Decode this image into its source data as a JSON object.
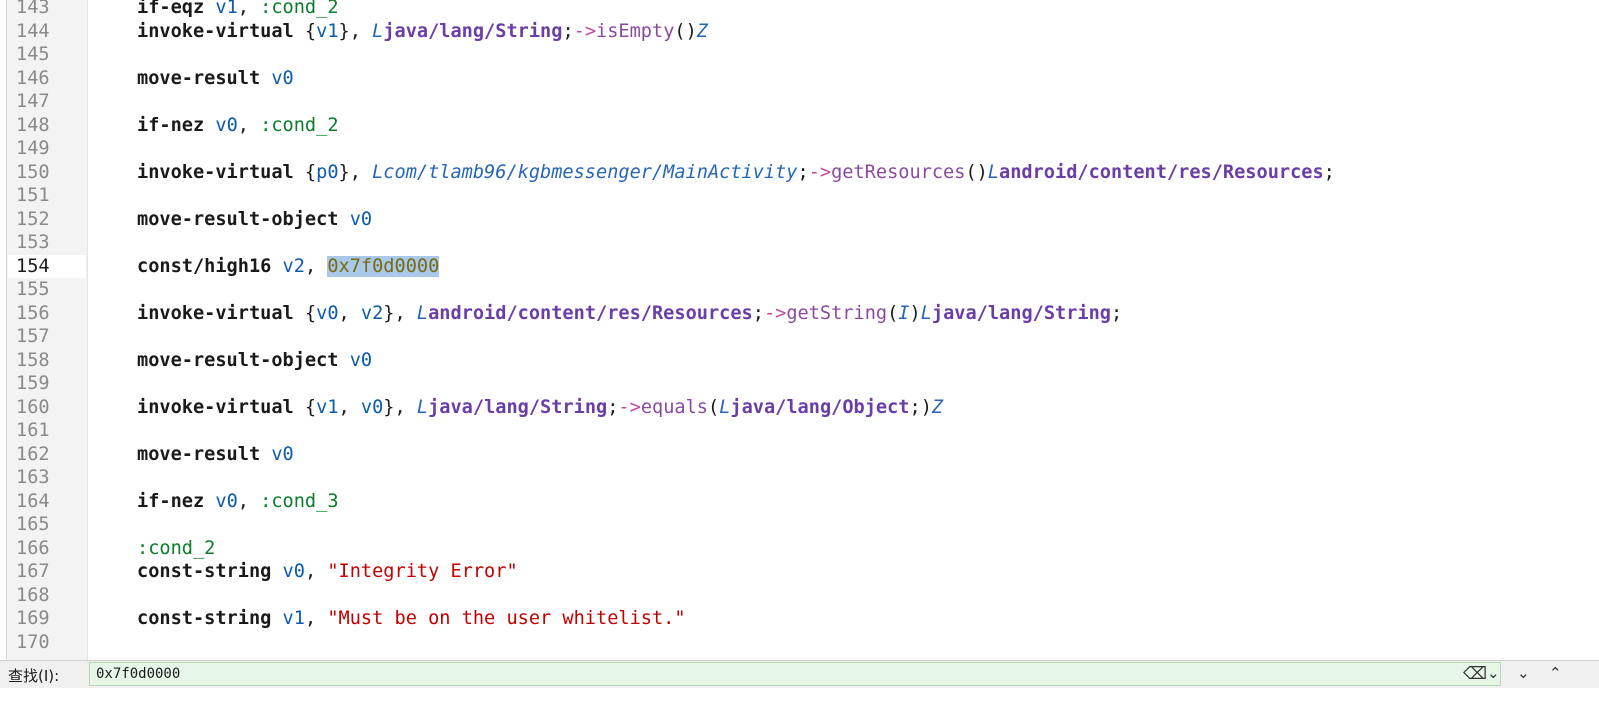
{
  "editor": {
    "lines": [
      {
        "num": "143",
        "parts": [
          [
            "kw",
            "if-eqz"
          ],
          [
            "plain",
            " "
          ],
          [
            "reg",
            "v1"
          ],
          [
            "plain",
            ", "
          ],
          [
            "lbl",
            ":cond_2"
          ]
        ]
      },
      {
        "num": "144",
        "parts": [
          [
            "kw",
            "invoke-virtual"
          ],
          [
            "plain",
            " {"
          ],
          [
            "reg",
            "v1"
          ],
          [
            "plain",
            "}, "
          ],
          [
            "clsL",
            "L"
          ],
          [
            "cls",
            "java/lang/String"
          ],
          [
            "plain",
            ";"
          ],
          [
            "arrow",
            "->"
          ],
          [
            "meth",
            "isEmpty"
          ],
          [
            "plain",
            "()"
          ],
          [
            "prim",
            "Z"
          ]
        ]
      },
      {
        "num": "145",
        "parts": []
      },
      {
        "num": "146",
        "parts": [
          [
            "kw",
            "move-result"
          ],
          [
            "plain",
            " "
          ],
          [
            "reg",
            "v0"
          ]
        ]
      },
      {
        "num": "147",
        "parts": []
      },
      {
        "num": "148",
        "parts": [
          [
            "kw",
            "if-nez"
          ],
          [
            "plain",
            " "
          ],
          [
            "reg",
            "v0"
          ],
          [
            "plain",
            ", "
          ],
          [
            "lbl",
            ":cond_2"
          ]
        ]
      },
      {
        "num": "149",
        "parts": []
      },
      {
        "num": "150",
        "parts": [
          [
            "kw",
            "invoke-virtual"
          ],
          [
            "plain",
            " {"
          ],
          [
            "reg",
            "p0"
          ],
          [
            "plain",
            "}, "
          ],
          [
            "pkgL",
            "Lcom/tlamb96/kgbmessenger/MainActivity"
          ],
          [
            "plain",
            ";"
          ],
          [
            "arrow",
            "->"
          ],
          [
            "meth",
            "getResources"
          ],
          [
            "plain",
            "()"
          ],
          [
            "clsL",
            "L"
          ],
          [
            "cls",
            "android/content/res/Resources"
          ],
          [
            "plain",
            ";"
          ]
        ]
      },
      {
        "num": "151",
        "parts": []
      },
      {
        "num": "152",
        "parts": [
          [
            "kw",
            "move-result-object"
          ],
          [
            "plain",
            " "
          ],
          [
            "reg",
            "v0"
          ]
        ]
      },
      {
        "num": "153",
        "parts": []
      },
      {
        "num": "154",
        "current": true,
        "parts": [
          [
            "kw",
            "const/high16"
          ],
          [
            "plain",
            " "
          ],
          [
            "reg",
            "v2"
          ],
          [
            "plain",
            ", "
          ],
          [
            "hexhl",
            "0x7f0d0000"
          ]
        ]
      },
      {
        "num": "155",
        "parts": []
      },
      {
        "num": "156",
        "parts": [
          [
            "kw",
            "invoke-virtual"
          ],
          [
            "plain",
            " {"
          ],
          [
            "reg",
            "v0"
          ],
          [
            "plain",
            ", "
          ],
          [
            "reg",
            "v2"
          ],
          [
            "plain",
            "}, "
          ],
          [
            "clsL",
            "L"
          ],
          [
            "cls",
            "android/content/res/Resources"
          ],
          [
            "plain",
            ";"
          ],
          [
            "arrow",
            "->"
          ],
          [
            "meth",
            "getString"
          ],
          [
            "plain",
            "("
          ],
          [
            "prim",
            "I"
          ],
          [
            "plain",
            ")"
          ],
          [
            "clsL",
            "L"
          ],
          [
            "cls",
            "java/lang/String"
          ],
          [
            "plain",
            ";"
          ]
        ]
      },
      {
        "num": "157",
        "parts": []
      },
      {
        "num": "158",
        "parts": [
          [
            "kw",
            "move-result-object"
          ],
          [
            "plain",
            " "
          ],
          [
            "reg",
            "v0"
          ]
        ]
      },
      {
        "num": "159",
        "parts": []
      },
      {
        "num": "160",
        "parts": [
          [
            "kw",
            "invoke-virtual"
          ],
          [
            "plain",
            " {"
          ],
          [
            "reg",
            "v1"
          ],
          [
            "plain",
            ", "
          ],
          [
            "reg",
            "v0"
          ],
          [
            "plain",
            "}, "
          ],
          [
            "clsL",
            "L"
          ],
          [
            "cls",
            "java/lang/String"
          ],
          [
            "plain",
            ";"
          ],
          [
            "arrow",
            "->"
          ],
          [
            "meth",
            "equals"
          ],
          [
            "plain",
            "("
          ],
          [
            "clsL",
            "L"
          ],
          [
            "cls",
            "java/lang/Object"
          ],
          [
            "plain",
            ";)"
          ],
          [
            "prim",
            "Z"
          ]
        ]
      },
      {
        "num": "161",
        "parts": []
      },
      {
        "num": "162",
        "parts": [
          [
            "kw",
            "move-result"
          ],
          [
            "plain",
            " "
          ],
          [
            "reg",
            "v0"
          ]
        ]
      },
      {
        "num": "163",
        "parts": []
      },
      {
        "num": "164",
        "parts": [
          [
            "kw",
            "if-nez"
          ],
          [
            "plain",
            " "
          ],
          [
            "reg",
            "v0"
          ],
          [
            "plain",
            ", "
          ],
          [
            "lbl",
            ":cond_3"
          ]
        ]
      },
      {
        "num": "165",
        "parts": []
      },
      {
        "num": "166",
        "parts": [
          [
            "lbl",
            ":cond_2"
          ]
        ]
      },
      {
        "num": "167",
        "parts": [
          [
            "kw",
            "const-string"
          ],
          [
            "plain",
            " "
          ],
          [
            "reg",
            "v0"
          ],
          [
            "plain",
            ", "
          ],
          [
            "str",
            "\"Integrity Error\""
          ]
        ]
      },
      {
        "num": "168",
        "parts": []
      },
      {
        "num": "169",
        "parts": [
          [
            "kw",
            "const-string"
          ],
          [
            "plain",
            " "
          ],
          [
            "reg",
            "v1"
          ],
          [
            "plain",
            ", "
          ],
          [
            "str",
            "\"Must be on the user whitelist.\""
          ]
        ]
      },
      {
        "num": "170",
        "parts": []
      }
    ]
  },
  "findbar": {
    "label": "查找(I):",
    "value": "0x7f0d0000",
    "clear_icon": "clear-text-icon",
    "options_icon": "chevron-down-icon",
    "next_icon": "chevron-down-icon",
    "prev_icon": "chevron-up-icon"
  }
}
